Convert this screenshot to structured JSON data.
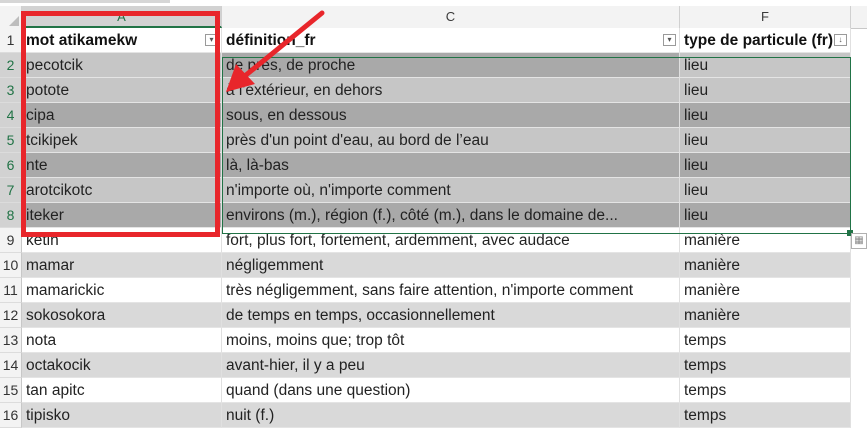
{
  "columns": [
    {
      "letter": "A",
      "header": "mot atikamekw"
    },
    {
      "letter": "C",
      "header": "définition_fr"
    },
    {
      "letter": "F",
      "header": "type de particule (fr)"
    }
  ],
  "rows": [
    {
      "num": "2",
      "a": "pecotcik",
      "c": "de près, de proche",
      "f": "lieu"
    },
    {
      "num": "3",
      "a": "potote",
      "c": "à l'extérieur, en dehors",
      "f": "lieu"
    },
    {
      "num": "4",
      "a": "cipa",
      "c": "sous, en dessous",
      "f": "lieu"
    },
    {
      "num": "5",
      "a": "tcikipek",
      "c": "près d'un point d'eau, au bord de l’eau",
      "f": "lieu"
    },
    {
      "num": "6",
      "a": "nte",
      "c": "là, là-bas",
      "f": "lieu"
    },
    {
      "num": "7",
      "a": "arotcikotc",
      "c": "n'importe où, n'importe comment",
      "f": "lieu"
    },
    {
      "num": "8",
      "a": "iteker",
      "c": "environs (m.), région (f.), côté (m.), dans le domaine de...",
      "f": "lieu"
    },
    {
      "num": "9",
      "a": "ketin",
      "c": "fort, plus fort, fortement, ardemment, avec audace",
      "f": "manière"
    },
    {
      "num": "10",
      "a": "mamar",
      "c": "négligemment",
      "f": "manière"
    },
    {
      "num": "11",
      "a": "mamarickic",
      "c": "très négligemment, sans faire attention, n'importe comment",
      "f": "manière"
    },
    {
      "num": "12",
      "a": "sokosokora",
      "c": "de temps en temps, occasionnellement",
      "f": "manière"
    },
    {
      "num": "13",
      "a": "nota",
      "c": "moins, moins que; trop tôt",
      "f": "temps"
    },
    {
      "num": "14",
      "a": "octakocik",
      "c": "avant-hier, il y a peu",
      "f": "temps"
    },
    {
      "num": "15",
      "a": "tan apitc",
      "c": "quand (dans une question)",
      "f": "temps"
    },
    {
      "num": "16",
      "a": "tipisko",
      "c": "nuit (f.)",
      "f": "temps"
    }
  ],
  "header_row_num": "1",
  "colors": {
    "accent": "#217346",
    "annotation": "#e8262b"
  }
}
